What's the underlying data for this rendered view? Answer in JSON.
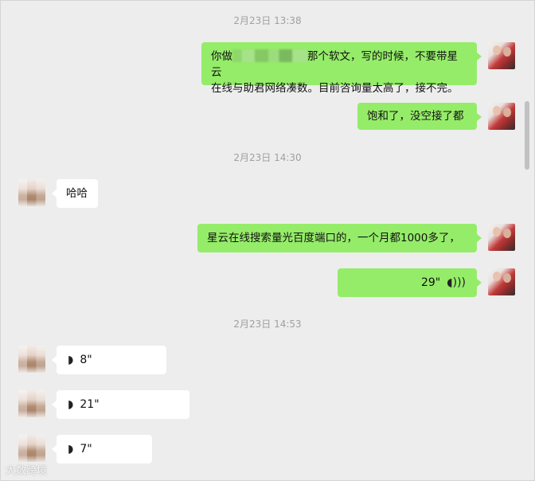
{
  "chat": {
    "timestamps": [
      "2月23日 13:38",
      "2月23日 14:30",
      "2月23日 14:53"
    ],
    "messages": {
      "m1": {
        "before": "你做",
        "after": "那个软文，写的时候，不要带星云",
        "line2": "在线与助君网络凑数。目前咨询量太高了，接不完。"
      },
      "m2": {
        "text": "饱和了，没空接了都"
      },
      "m3": {
        "text": "哈哈"
      },
      "m4": {
        "text": "星云在线搜索量光百度端口的，一个月都1000多了，"
      },
      "m5": {
        "duration": "29\""
      },
      "m6": {
        "duration": "8\""
      },
      "m7": {
        "duration": "21\""
      },
      "m8": {
        "duration": "7\""
      }
    }
  },
  "icons": {
    "voice_in": "voice-wave-icon",
    "voice_out": "voice-wave-icon"
  },
  "colors": {
    "my_bubble": "#95ec69",
    "peer_bubble": "#ffffff",
    "background": "#ededed"
  },
  "watermark": "大数跨境"
}
